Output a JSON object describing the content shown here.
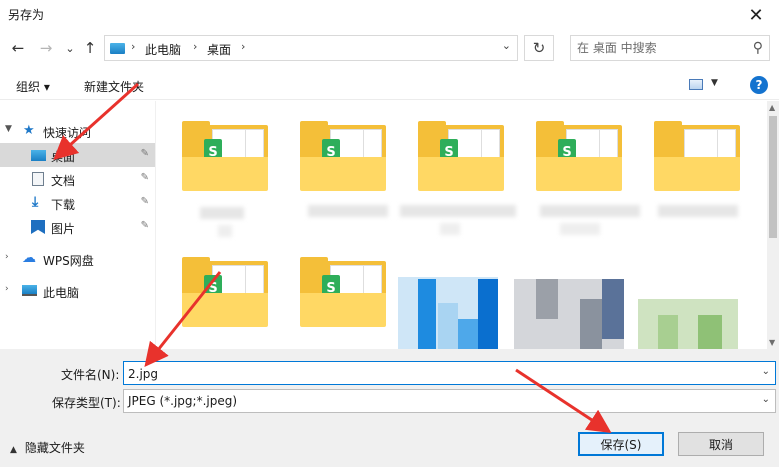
{
  "window": {
    "title": "另存为",
    "close_glyph": "✕"
  },
  "nav": {
    "back": "←",
    "forward": "→",
    "recent": "⌄",
    "up": "↑",
    "breadcrumb": [
      "此电脑",
      "桌面"
    ],
    "refresh": "↻",
    "search_placeholder": "在 桌面 中搜索"
  },
  "toolbar": {
    "organize": "组织 ▾",
    "new_folder": "新建文件夹",
    "help": "?"
  },
  "sidebar": {
    "items": [
      {
        "label": "快速访问",
        "icon": "star-icon",
        "expanded": true
      },
      {
        "label": "桌面",
        "icon": "desktop-icon",
        "selected": true,
        "pinned": true
      },
      {
        "label": "文档",
        "icon": "document-icon",
        "pinned": true
      },
      {
        "label": "下载",
        "icon": "download-icon",
        "pinned": true
      },
      {
        "label": "图片",
        "icon": "pictures-icon",
        "pinned": true
      },
      {
        "label": "WPS网盘",
        "icon": "cloud-icon"
      },
      {
        "label": "此电脑",
        "icon": "computer-icon"
      }
    ]
  },
  "form": {
    "filename_label": "文件名(N):",
    "filename_value": "2.jpg",
    "filetype_label": "保存类型(T):",
    "filetype_value": "JPEG (*.jpg;*.jpeg)",
    "hide_folders": "隐藏文件夹",
    "save": "保存(S)",
    "cancel": "取消"
  },
  "colors": {
    "accent": "#0078d7",
    "folder": "#f4bf39",
    "annotation_arrow": "#e8322c"
  }
}
